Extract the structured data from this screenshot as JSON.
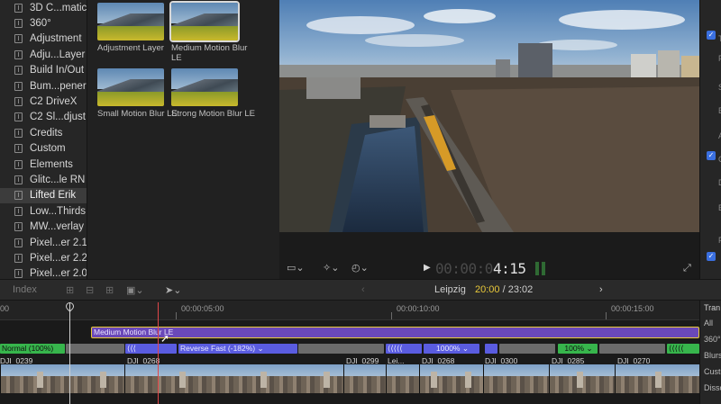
{
  "sidebar": {
    "items": [
      {
        "label": "3D C...matic"
      },
      {
        "label": "360°"
      },
      {
        "label": "Adjustment"
      },
      {
        "label": "Adju...Layer"
      },
      {
        "label": "Build In/Out"
      },
      {
        "label": "Bum...pener"
      },
      {
        "label": "C2 DriveX"
      },
      {
        "label": "C2 Sl...djust"
      },
      {
        "label": "Credits"
      },
      {
        "label": "Custom"
      },
      {
        "label": "Elements"
      },
      {
        "label": "Glitc...le RN"
      },
      {
        "label": "Lifted Erik",
        "selected": true
      },
      {
        "label": "Low...Thirds"
      },
      {
        "label": "MW...verlay"
      },
      {
        "label": "Pixel...er 2.1"
      },
      {
        "label": "Pixel...er 2.2"
      },
      {
        "label": "Pixel...er 2.0"
      }
    ]
  },
  "browser": {
    "items": [
      {
        "label": "Adjustment Layer"
      },
      {
        "label": "Medium Motion Blur LE"
      },
      {
        "label": "Small Motion Blur LE"
      },
      {
        "label": "Strong Motion Blur LE"
      }
    ]
  },
  "viewer": {
    "timecode_dim": "00:00:0",
    "timecode_lit": "4:15",
    "play_icon": "▶"
  },
  "timeline": {
    "toolbar": {
      "index_label": "Index",
      "project_name": "Leipzig",
      "position": "20:00",
      "separator": " / ",
      "duration": "23:02"
    },
    "ruler": {
      "labels": [
        "00:00:05:00",
        "00:00:10:00",
        "00:00:15:00",
        "00"
      ]
    },
    "title_clip": "Medium Motion Blur LE",
    "retime": [
      {
        "label": "Normal (100%)",
        "kind": "green"
      },
      {
        "label": "Reverse Fast (-182%) ⌄",
        "kind": "blue"
      },
      {
        "label": "1000% ⌄",
        "kind": "blue"
      },
      {
        "label": "100% ⌄",
        "kind": "green"
      }
    ],
    "clips": [
      {
        "name": "DJI_0239"
      },
      {
        "name": "DJI_0268"
      },
      {
        "name": "DJI_0299"
      },
      {
        "name": "Lei..."
      },
      {
        "name": "DJI_0268"
      },
      {
        "name": "DJI_0300"
      },
      {
        "name": "DJI_0285"
      },
      {
        "name": "DJI_0270"
      }
    ]
  },
  "fx_panel": {
    "header": "Tran",
    "items": [
      "All",
      "360°",
      "Blurs",
      "Custo",
      "Disso"
    ]
  },
  "inspector": {
    "letters": [
      "T",
      "F",
      "S",
      "B",
      "A",
      "C",
      "D",
      "E",
      "F"
    ]
  },
  "colors": {
    "accent_blue": "#3a6fe0",
    "title_purple": "#6a48b8",
    "retime_green": "#37b54c",
    "retime_blue": "#5a5ce0",
    "playhead_red": "#e0474a"
  }
}
